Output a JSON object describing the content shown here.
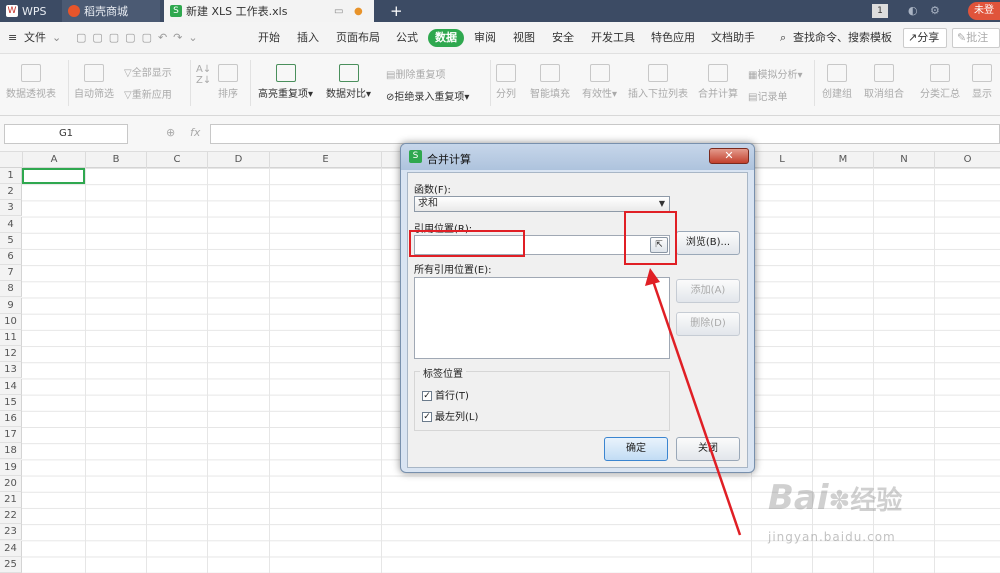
{
  "tabs": [
    {
      "label": "WPS",
      "color": "#c8332b"
    },
    {
      "label": "稻壳商城",
      "color": "#e8552a"
    },
    {
      "label": "新建 XLS 工作表.xls",
      "color": "#2fa84f"
    }
  ],
  "title_right": {
    "badge": "1",
    "user": "未登"
  },
  "menu": {
    "file": "文件",
    "items": [
      "开始",
      "插入",
      "页面布局",
      "公式",
      "数据",
      "审阅",
      "视图",
      "安全",
      "开发工具",
      "特色应用",
      "文档助手"
    ],
    "active": "数据",
    "search": "查找命令、搜索模板",
    "share": "分享",
    "comment": "批注"
  },
  "ribbon": [
    "数据透视表",
    "自动筛选",
    "全部显示",
    "重新应用",
    "排序",
    "高亮重复项",
    "数据对比",
    "删除重复项",
    "拒绝录入重复项",
    "分列",
    "智能填充",
    "有效性",
    "插入下拉列表",
    "合并计算",
    "模拟分析",
    "记录单",
    "创建组",
    "取消组合",
    "分类汇总",
    "显示"
  ],
  "namebox": "G1",
  "fx": "fx",
  "columns": [
    "A",
    "B",
    "C",
    "D",
    "E",
    "",
    "",
    "",
    "",
    "",
    "",
    "L",
    "M",
    "N",
    "O"
  ],
  "rows": [
    "1",
    "2",
    "3",
    "4",
    "5",
    "6",
    "7",
    "8",
    "9",
    "10",
    "11",
    "12",
    "13",
    "14",
    "15",
    "16",
    "17",
    "18",
    "19",
    "20",
    "21",
    "22",
    "23",
    "24",
    "25"
  ],
  "dialog": {
    "title": "合并计算",
    "function_label": "函数(F):",
    "function_value": "求和",
    "ref_label": "引用位置(R):",
    "ref_value": "",
    "browse": "浏览(B)...",
    "all_refs_label": "所有引用位置(E):",
    "add": "添加(A)",
    "delete": "删除(D)",
    "label_group": "标签位置",
    "top_row": "首行(T)",
    "left_col": "最左列(L)",
    "ok": "确定",
    "close": "关闭"
  },
  "watermark": {
    "brand": "Bai",
    "brand2": "经验",
    "url": "jingyan.baidu.com"
  },
  "accent": "#2fa84f",
  "highlight": "#e01f25"
}
